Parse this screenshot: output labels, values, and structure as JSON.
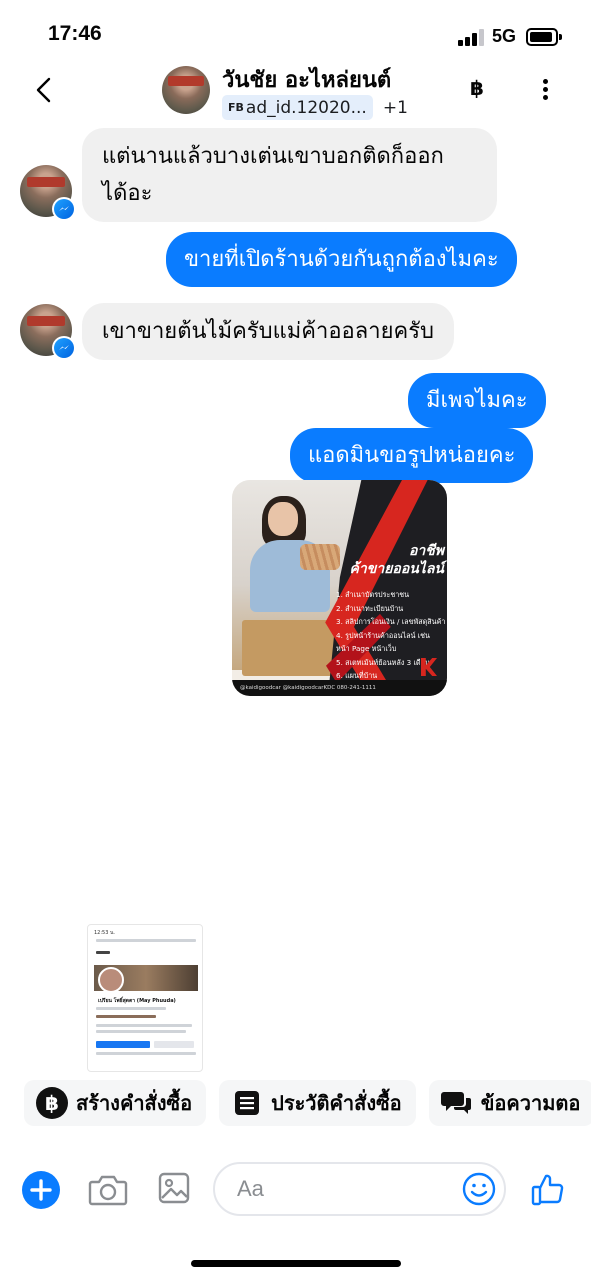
{
  "status_bar": {
    "time": "17:46",
    "network": "5G"
  },
  "header": {
    "contact_name": "วันชัย อะไหล่ยนต์",
    "fb_mark": "FB",
    "ad_label": "ad_id.12020...",
    "extra_count": "+1",
    "currency_symbol": "฿"
  },
  "messages": [
    {
      "direction": "in",
      "lines": [
        "แต่นานแล้วบางเต่นเขาบอกติดก็ออก",
        "ได้อะ"
      ]
    },
    {
      "direction": "out",
      "text": "ขายที่เปิดร้านด้วยกันถูกต้องไมคะ"
    },
    {
      "direction": "in",
      "text": "เขาขายต้นไม้ครับแม่ค้าออลายครับ"
    },
    {
      "direction": "out",
      "text": "มีเพจไมคะ"
    },
    {
      "direction": "out",
      "text": "แอดมินขอรูปหน่อยคะ"
    }
  ],
  "image_ad": {
    "title_line1": "อาชีพ",
    "title_line2": "ค้าขายออนไลน์",
    "items": [
      "1. สำเนาบัตรประชาชน",
      "2. สำเนาทะเบียนบ้าน",
      "3. สลิปการโอนเงิน / เลขพัสดุสินค้า",
      "4. รูปหน้าร้านค้าออนไลน์ เช่น",
      "หน้า Page หน้าเว็บ",
      "5. สเตทเม้นท์ย้อนหลัง 3 เดือน",
      "6. แผนที่บ้าน"
    ],
    "footer": "@kaidigoodcar   @kaidigoodcarKDC   080-241-1111"
  },
  "thumbnail": {
    "status_text": "12:53 น.",
    "profile_name": "เปรียน โพธิ์สุดตา (May Phuuda)"
  },
  "quick_replies": [
    {
      "icon": "baht",
      "symbol": "฿",
      "label": "สร้างคำสั่งซื้อ"
    },
    {
      "icon": "list",
      "label": "ประวัติคำสั่งซื้อ"
    },
    {
      "icon": "chat",
      "label": "ข้อความตอ"
    }
  ],
  "composer": {
    "placeholder": "Aa"
  },
  "colors": {
    "accent": "#0a7cff",
    "incoming_bubble": "#f0f0f0",
    "ad_red": "#d7261f"
  }
}
